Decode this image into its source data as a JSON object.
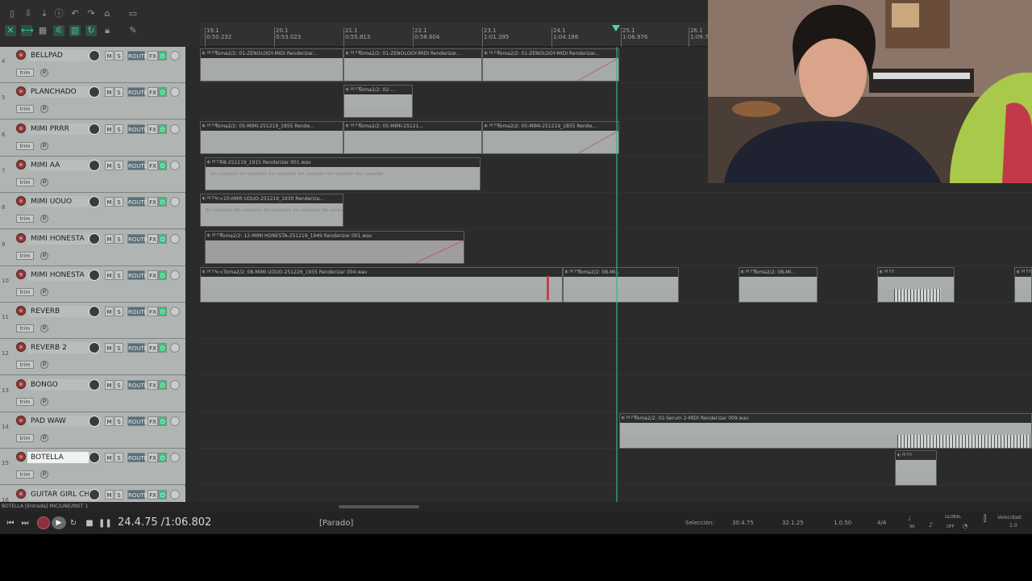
{
  "ruler": {
    "marks": [
      {
        "bar": "19.1",
        "time": "0:50.232"
      },
      {
        "bar": "20.1",
        "time": "0:53.023"
      },
      {
        "bar": "21.1",
        "time": "0:55.813"
      },
      {
        "bar": "22.1",
        "time": "0:58.604"
      },
      {
        "bar": "23.1",
        "time": "1:01.395"
      },
      {
        "bar": "24.1",
        "time": "1:04.186"
      },
      {
        "bar": "25.1",
        "time": "1:06.976"
      },
      {
        "bar": "26.1",
        "time": "1:09.76"
      }
    ]
  },
  "tracks": [
    {
      "num": "4",
      "name": "BELLPAD"
    },
    {
      "num": "5",
      "name": "PLANCHADO"
    },
    {
      "num": "6",
      "name": "MIMI PRRR"
    },
    {
      "num": "7",
      "name": "MIMI AA"
    },
    {
      "num": "8",
      "name": "MIMI UOUO"
    },
    {
      "num": "9",
      "name": "MIMI HONESTA"
    },
    {
      "num": "10",
      "name": "MIMI HONESTA"
    },
    {
      "num": "11",
      "name": "REVERB"
    },
    {
      "num": "12",
      "name": "REVERB 2"
    },
    {
      "num": "13",
      "name": "BONGO"
    },
    {
      "num": "14",
      "name": "PAD WAW"
    },
    {
      "num": "15",
      "name": "BOTELLA"
    },
    {
      "num": "16",
      "name": "GUITAR GIRL CHE"
    }
  ],
  "track_buttons": {
    "mute": "M",
    "solo": "S",
    "route": "ROUTE",
    "fx": "FX",
    "trim": "trim",
    "phase": "Ø"
  },
  "items": {
    "i1": "Toma2/2: 01-ZENOLOGY-MIDI Renderizar...",
    "i2": "Toma2/2: 01-ZENOLOGY-MIDI Renderizar...",
    "i3": "Toma2/2: 01-ZENOLOGY-MIDI Renderizar...",
    "i4": "Toma2/2: 02-...",
    "i5": "Toma2/2: 05-MIMI-251219_1855 Rende...",
    "i6": "Toma2/2: 05-MIMI-25121...",
    "i7": "Toma2/2: 05-MIMI-251219_1855 Rende...",
    "i8": "08-251219_1915 Renderizar 001.wav",
    "i9": "<<10-MIMI UOUO-251219_1930 Renderiza...",
    "i10": "Toma2/2: 12-MIMI HONESTA-251219_1949 Renderizar 001.wav",
    "i11": "<<Toma2/2: 08-MIMI UOUO-251226_1935 Renderizar 004.wav",
    "i12": "Toma2/2: 08-MI...",
    "i13": "Toma2/2: 08-MI...",
    "i14": "Toma2/2: 02-Serum 2-MIDI Renderizar 009.wav",
    "sinconex": "Sin conexión   Sin conexión   Sin conexión   Sin conexión   Sin conexión   Sin conexión"
  },
  "status": {
    "track_info": "BOTELLA [Entrada] MIC/LINE/INST 1",
    "timecode": "24.4.75 /1:06.802",
    "state": "[Parado]",
    "selection_label": "Selección:",
    "sel_start": "30.4.75",
    "sel_end": "32.1.25",
    "sel_len": "1.0.50",
    "timesig": "4/4",
    "bpm": "96",
    "global": "GLOBAL",
    "off": "OFF",
    "velocidad_label": "Velocidad:",
    "velocidad": "1.0"
  }
}
